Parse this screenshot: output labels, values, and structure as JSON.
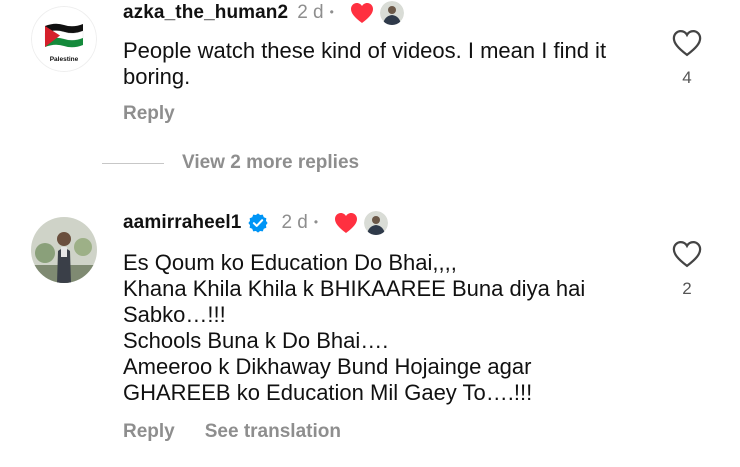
{
  "comments": [
    {
      "username": "azka_the_human2",
      "time": "2 d",
      "avatar_text": "Palestine",
      "text": "People watch these kind of videos. I mean I find it\nboring.",
      "like_count": "4",
      "actions": {
        "reply": "Reply"
      }
    },
    {
      "username": "aamirraheel1",
      "time": "2 d",
      "text": "Es Qoum ko Education Do Bhai,,,,\n Khana Khila Khila k BHIKAAREE Buna diya hai\nSabko…!!!\nSchools Buna k Do Bhai….\nAmeeroo k Dikhaway Bund Hojainge agar\nGHAREEB ko Education Mil Gaey To….!!!",
      "like_count": "2",
      "actions": {
        "reply": "Reply",
        "translate": "See translation"
      }
    }
  ],
  "view_more": "View 2 more replies",
  "colors": {
    "heart_red": "#ff3040",
    "verified_blue": "#0095f6",
    "muted": "#8e8e8e"
  }
}
